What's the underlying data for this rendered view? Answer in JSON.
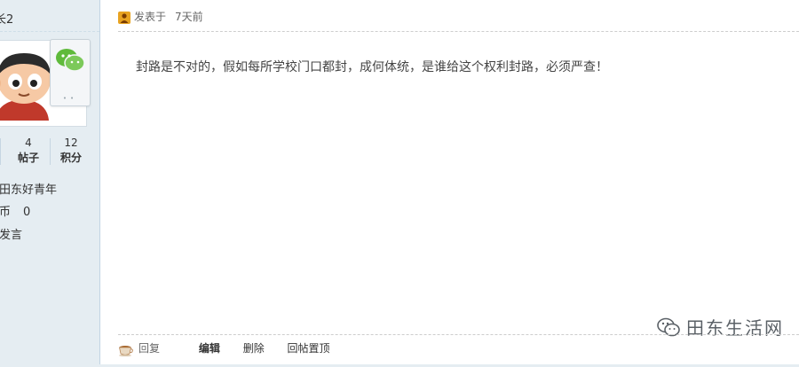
{
  "sidebar": {
    "username": "长2",
    "stats": [
      {
        "value": "",
        "label": ""
      },
      {
        "value": "4",
        "label": "帖子"
      },
      {
        "value": "12",
        "label": "积分"
      }
    ],
    "user_group": "田东好青年",
    "coins": {
      "label": "币",
      "value": "0"
    },
    "send_message": "发言"
  },
  "post": {
    "meta_label": "发表于",
    "time": "7天前",
    "body": "封路是不对的，假如每所学校门口都封，成何体统，是谁给这个权利封路，必须严查！"
  },
  "watermark": {
    "text": "田东生活网"
  },
  "actions": {
    "reply": "回复",
    "edit": "编辑",
    "delete": "删除",
    "pin": "回帖置顶"
  },
  "colors": {
    "sidebar_bg": "#e5edf2",
    "wechat_green": "#5fba3b"
  }
}
